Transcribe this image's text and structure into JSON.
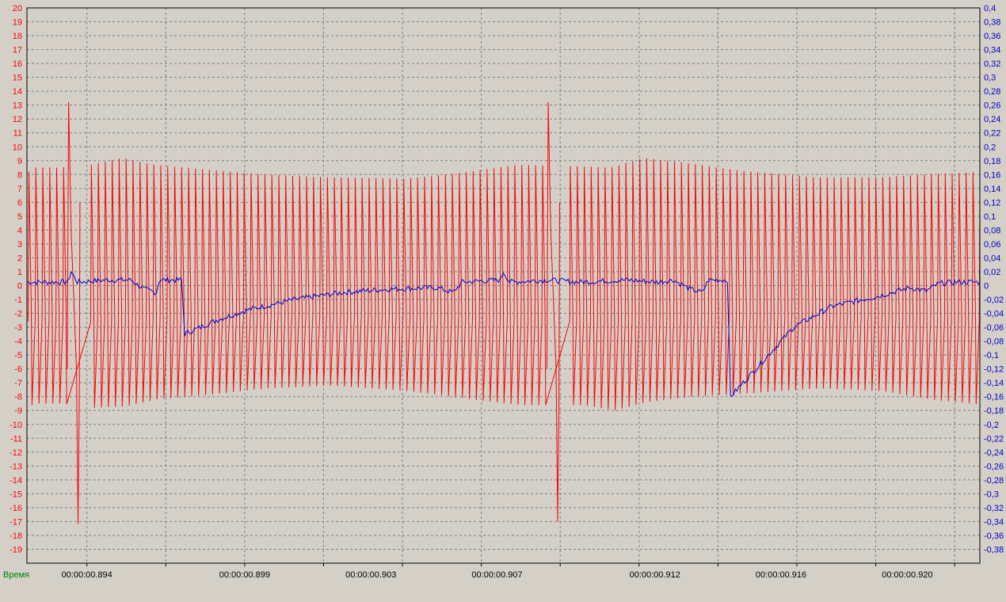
{
  "chart_data": {
    "type": "line",
    "xlabel": "Время",
    "x_ticks": [
      "00:00:00.894",
      "00:00:00.899",
      "00:00:00.903",
      "00:00:00.907",
      "00:00:00.912",
      "00:00:00.916",
      "00:00:00.920"
    ],
    "x_tick_positions": [
      0.8944,
      0.8994,
      0.9034,
      0.9074,
      0.9124,
      0.9164,
      0.9204
    ],
    "xlim": [
      0.8925,
      0.9227
    ],
    "grid": true,
    "y_left": {
      "lim": [
        -20,
        20
      ],
      "ticks": [
        "20",
        "19",
        "18",
        "17",
        "16",
        "15",
        "14",
        "13",
        "12",
        "11",
        "10",
        "9",
        "8",
        "7",
        "6",
        "5",
        "4",
        "3",
        "2",
        "1",
        "0",
        "-1",
        "-2",
        "-3",
        "-4",
        "-5",
        "-6",
        "-7",
        "-8",
        "-9",
        "-10",
        "-11",
        "-12",
        "-13",
        "-14",
        "-15",
        "-16",
        "-17",
        "-18",
        "-19"
      ],
      "color": "#ff0000"
    },
    "y_right": {
      "lim": [
        -0.4,
        0.4
      ],
      "ticks": [
        "0,4",
        "0,38",
        "0,36",
        "0,34",
        "0,32",
        "0,3",
        "0,28",
        "0,26",
        "0,24",
        "0,22",
        "0,2",
        "0,18",
        "0,16",
        "0,14",
        "0,12",
        "0,1",
        "0,08",
        "0,06",
        "0,04",
        "0,02",
        "0",
        "-0,02",
        "-0,04",
        "-0,06",
        "-0,08",
        "-0,1",
        "-0,12",
        "-0,14",
        "-0,16",
        "-0,18",
        "-0,2",
        "-0,22",
        "-0,24",
        "-0,26",
        "-0,28",
        "-0,3",
        "-0,32",
        "-0,34",
        "-0,36",
        "-0,38"
      ],
      "color": "#0000cc"
    },
    "series": [
      {
        "axis": "left",
        "color": "#ff0000",
        "oscillation_period": 0.00022,
        "envelope": [
          {
            "x": 0.8926,
            "hi": 8.5,
            "lo": -8.5
          },
          {
            "x": 0.8935,
            "hi": 8.5,
            "lo": -8.5
          },
          {
            "x": 0.8945,
            "hi": 8.7,
            "lo": -8.8
          },
          {
            "x": 0.8955,
            "hi": 9.2,
            "lo": -8.7
          },
          {
            "x": 0.8965,
            "hi": 8.7,
            "lo": -8.2
          },
          {
            "x": 0.898,
            "hi": 8.4,
            "lo": -7.9
          },
          {
            "x": 0.9,
            "hi": 8.0,
            "lo": -7.4
          },
          {
            "x": 0.902,
            "hi": 7.8,
            "lo": -7.2
          },
          {
            "x": 0.9045,
            "hi": 7.7,
            "lo": -7.6
          },
          {
            "x": 0.9065,
            "hi": 8.2,
            "lo": -8.2
          },
          {
            "x": 0.908,
            "hi": 8.7,
            "lo": -8.6
          },
          {
            "x": 0.91,
            "hi": 8.6,
            "lo": -8.6
          },
          {
            "x": 0.911,
            "hi": 8.5,
            "lo": -9.0
          },
          {
            "x": 0.912,
            "hi": 9.2,
            "lo": -8.4
          },
          {
            "x": 0.9135,
            "hi": 8.8,
            "lo": -8.0
          },
          {
            "x": 0.915,
            "hi": 8.3,
            "lo": -7.8
          },
          {
            "x": 0.9175,
            "hi": 7.8,
            "lo": -7.4
          },
          {
            "x": 0.9195,
            "hi": 7.8,
            "lo": -7.6
          },
          {
            "x": 0.921,
            "hi": 8.0,
            "lo": -8.2
          },
          {
            "x": 0.9227,
            "hi": 8.2,
            "lo": -8.6
          }
        ],
        "spikes": [
          {
            "x": 0.89382,
            "y": 13.2
          },
          {
            "x": 0.89412,
            "y": -17.2
          },
          {
            "x": 0.90902,
            "y": 13.2
          },
          {
            "x": 0.90932,
            "y": -17.0
          }
        ],
        "gaps": [
          [
            0.8938,
            0.8944
          ],
          [
            0.909,
            0.9096
          ]
        ]
      },
      {
        "axis": "right",
        "color": "#0000cc",
        "points": [
          [
            0.8925,
            0.005
          ],
          [
            0.8938,
            0.005
          ],
          [
            0.8939,
            0.02
          ],
          [
            0.8941,
            0.005
          ],
          [
            0.895,
            0.008
          ],
          [
            0.8958,
            0.008
          ],
          [
            0.8962,
            -0.005
          ],
          [
            0.8966,
            -0.01
          ],
          [
            0.8967,
            0.008
          ],
          [
            0.8974,
            0.008
          ],
          [
            0.8975,
            -0.07
          ],
          [
            0.8985,
            -0.05
          ],
          [
            0.8995,
            -0.035
          ],
          [
            0.901,
            -0.02
          ],
          [
            0.9025,
            -0.01
          ],
          [
            0.904,
            -0.005
          ],
          [
            0.9055,
            -0.003
          ],
          [
            0.906,
            -0.01
          ],
          [
            0.9063,
            0.005
          ],
          [
            0.9075,
            0.008
          ],
          [
            0.9076,
            0.02
          ],
          [
            0.9078,
            0.005
          ],
          [
            0.909,
            0.008
          ],
          [
            0.91,
            0.005
          ],
          [
            0.9115,
            0.008
          ],
          [
            0.9125,
            0.005
          ],
          [
            0.913,
            0.008
          ],
          [
            0.9135,
            -0.005
          ],
          [
            0.9139,
            -0.01
          ],
          [
            0.9141,
            0.008
          ],
          [
            0.9147,
            0.008
          ],
          [
            0.9148,
            -0.16
          ],
          [
            0.9156,
            -0.12
          ],
          [
            0.9168,
            -0.06
          ],
          [
            0.918,
            -0.03
          ],
          [
            0.9195,
            -0.015
          ],
          [
            0.9205,
            -0.003
          ],
          [
            0.921,
            -0.008
          ],
          [
            0.9214,
            0.003
          ],
          [
            0.922,
            0.005
          ],
          [
            0.9227,
            0.005
          ]
        ]
      }
    ]
  }
}
